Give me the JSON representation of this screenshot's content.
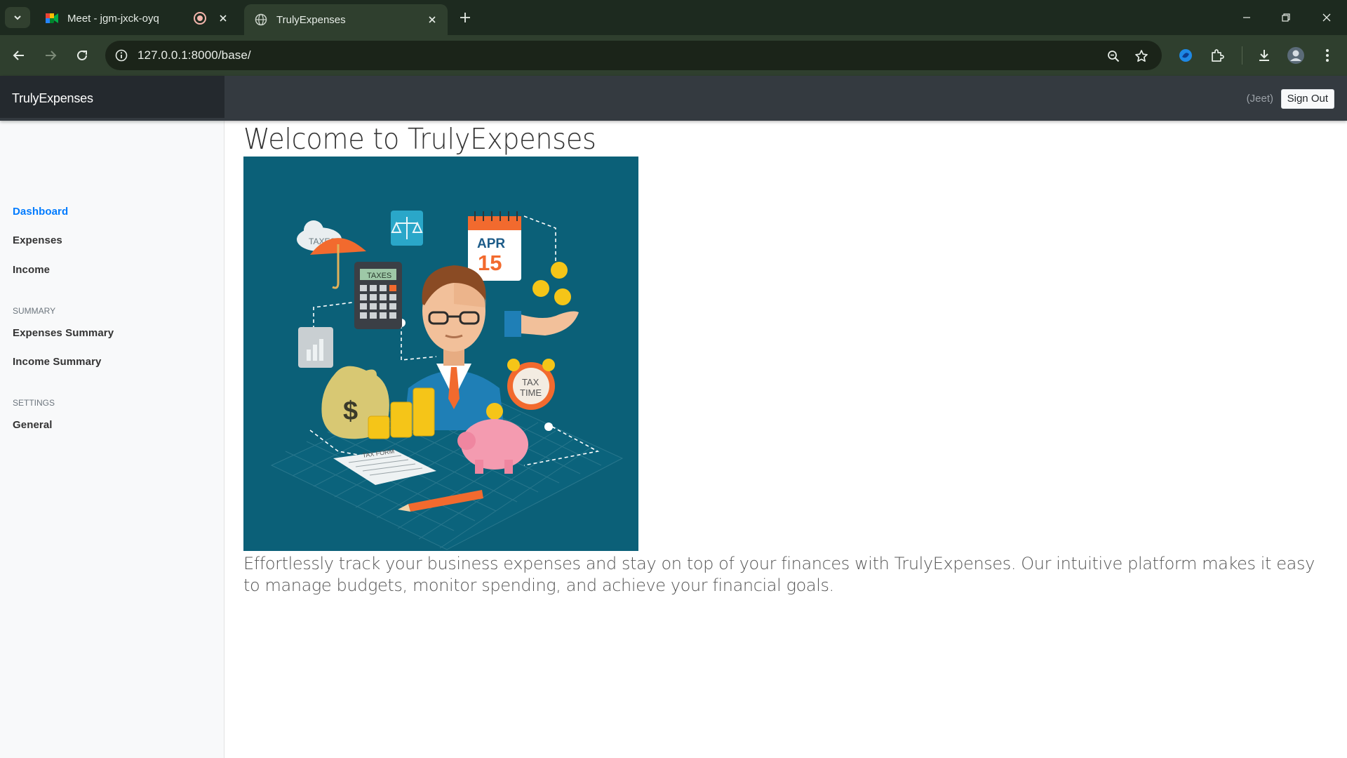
{
  "browser": {
    "tabs": [
      {
        "title": "Meet - jgm-jxck-oyq",
        "active": false,
        "recording": true
      },
      {
        "title": "TrulyExpenses",
        "active": true
      }
    ],
    "url": "127.0.0.1:8000/base/"
  },
  "navbar": {
    "brand": "TrulyExpenses",
    "user": "(Jeet)",
    "signout_label": "Sign Out"
  },
  "sidebar": {
    "links": [
      "Dashboard",
      "Expenses",
      "Income"
    ],
    "summary_heading": "SUMMARY",
    "summary_links": [
      "Expenses Summary",
      "Income Summary"
    ],
    "settings_heading": "SETTINGS",
    "settings_links": [
      "General"
    ]
  },
  "main": {
    "title": "Welcome to TrulyExpenses",
    "illustration": {
      "labels": {
        "taxes_cloud": "TAXES",
        "calculator": "TAXES",
        "calendar_month": "APR",
        "calendar_day": "15",
        "clock_line1": "TAX",
        "clock_line2": "TIME",
        "tax_form": "TAX FORM"
      }
    },
    "tagline": "Effortlessly track your business expenses and stay on top of your finances with TrulyExpenses. Our intuitive platform makes it easy to manage budgets, monitor spending, and achieve your financial goals."
  },
  "colors": {
    "navbar": "#343a40",
    "brand_bg": "#24292e",
    "active_link": "#007bff",
    "illustration_bg": "#0b6078"
  }
}
